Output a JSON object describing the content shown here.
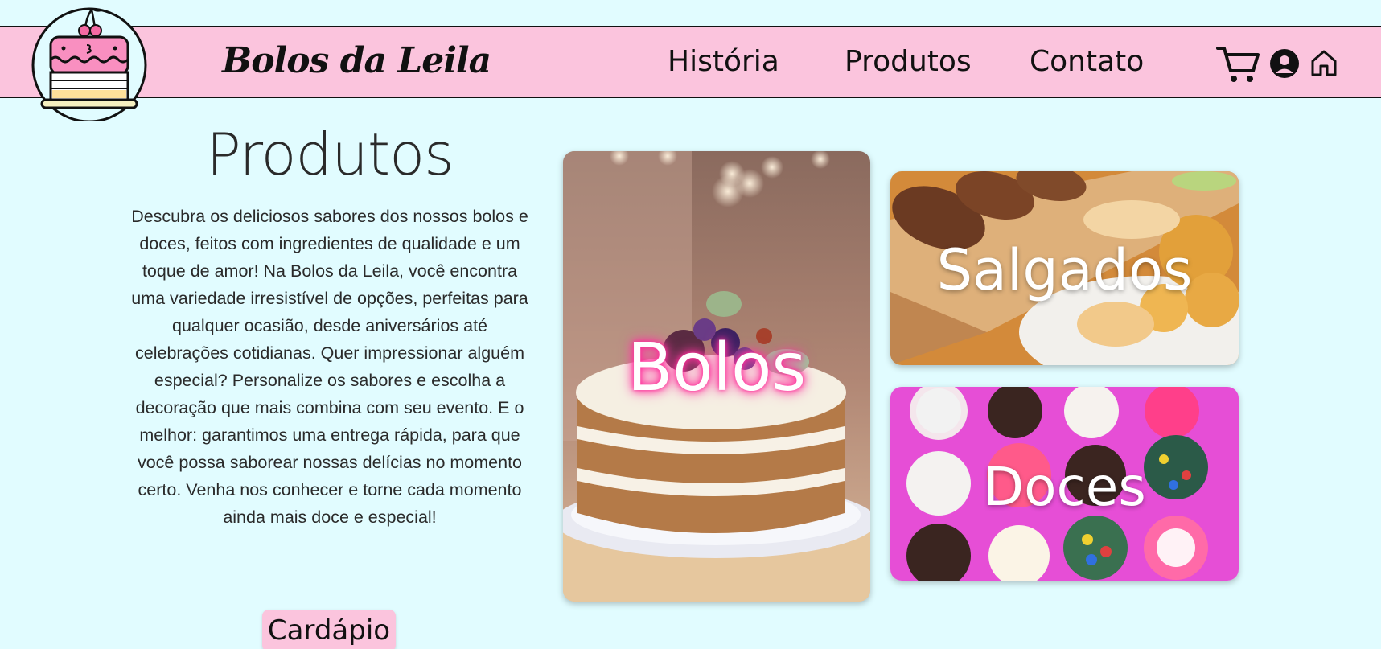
{
  "header": {
    "brand": "Bolos da Leila",
    "nav": [
      {
        "label": "História"
      },
      {
        "label": "Produtos"
      },
      {
        "label": "Contato"
      }
    ],
    "icons": [
      "cake-logo-icon",
      "cart-icon",
      "user-icon",
      "home-icon"
    ]
  },
  "main": {
    "title": "Produtos",
    "description": "Descubra os deliciosos sabores dos nossos bolos e doces, feitos com ingredientes de qualidade e um toque de amor! Na Bolos da Leila, você encontra uma variedade irresistível de opções, perfeitas para qualquer ocasião, desde aniversários até celebrações cotidianas. Quer impressionar alguém especial? Personalize os sabores e escolha a decoração que mais combina com seu evento. E o melhor: garantimos uma entrega rápida, para que você possa saborear nossas delícias no momento certo. Venha nos conhecer e torne cada momento ainda mais doce e especial!",
    "menu_button": "Cardápio"
  },
  "cards": [
    {
      "label": "Bolos"
    },
    {
      "label": "Salgados"
    },
    {
      "label": "Doces"
    }
  ],
  "colors": {
    "background": "#e1fcff",
    "header": "#fbc4dd",
    "button": "#fbc4dd",
    "neon_pink": "#ff2d9a",
    "text": "#2a2a2a"
  }
}
